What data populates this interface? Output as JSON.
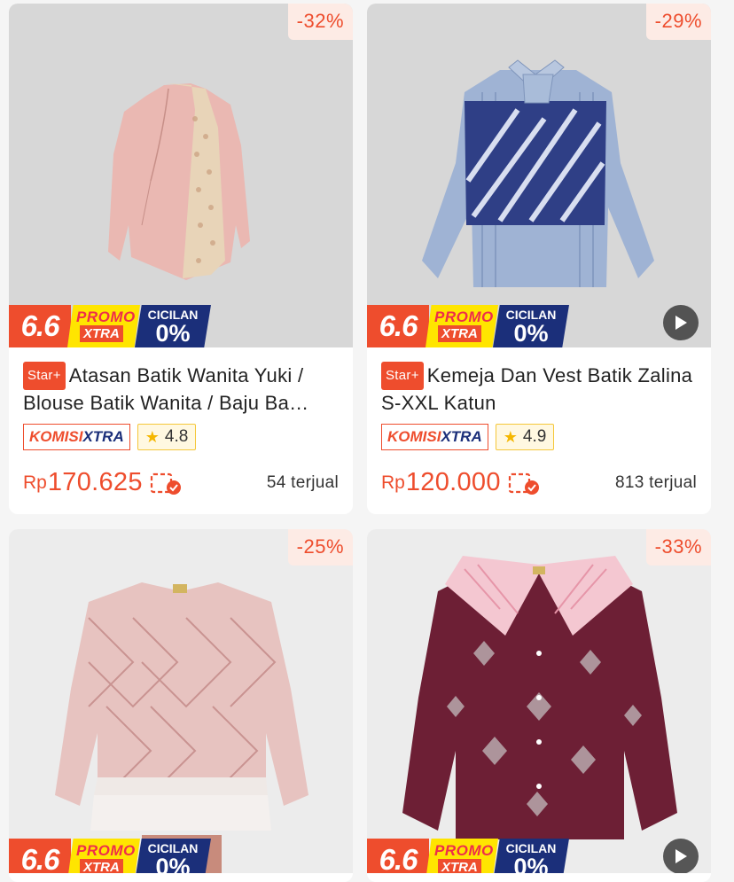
{
  "products": [
    {
      "discount": "-32%",
      "star_label": "Star+",
      "title": "Atasan Batik Wanita Yuki / Blouse Batik Wanita / Baju Ba…",
      "komisi_a": "KOMISI",
      "komisi_b": "XTRA",
      "rating": "4.8",
      "rp": "Rp",
      "price": "170.625",
      "sold": "54 terjual",
      "has_video": false
    },
    {
      "discount": "-29%",
      "star_label": "Star+",
      "title": "Kemeja Dan Vest Batik Zalina S-XXL Katun",
      "komisi_a": "KOMISI",
      "komisi_b": "XTRA",
      "rating": "4.9",
      "rp": "Rp",
      "price": "120.000",
      "sold": "813 terjual",
      "has_video": true
    },
    {
      "discount": "-25%",
      "has_video": false
    },
    {
      "discount": "-33%",
      "has_video": true
    }
  ],
  "promo": {
    "sale_label": "6.6",
    "promo_label": "PROMO",
    "xtra_label": "XTRA",
    "cicilan_label": "CICILAN",
    "cicilan_value": "0%"
  },
  "colors": {
    "accent": "#ee4d2d",
    "navy": "#1b2f7a",
    "yellow": "#ffe500"
  }
}
